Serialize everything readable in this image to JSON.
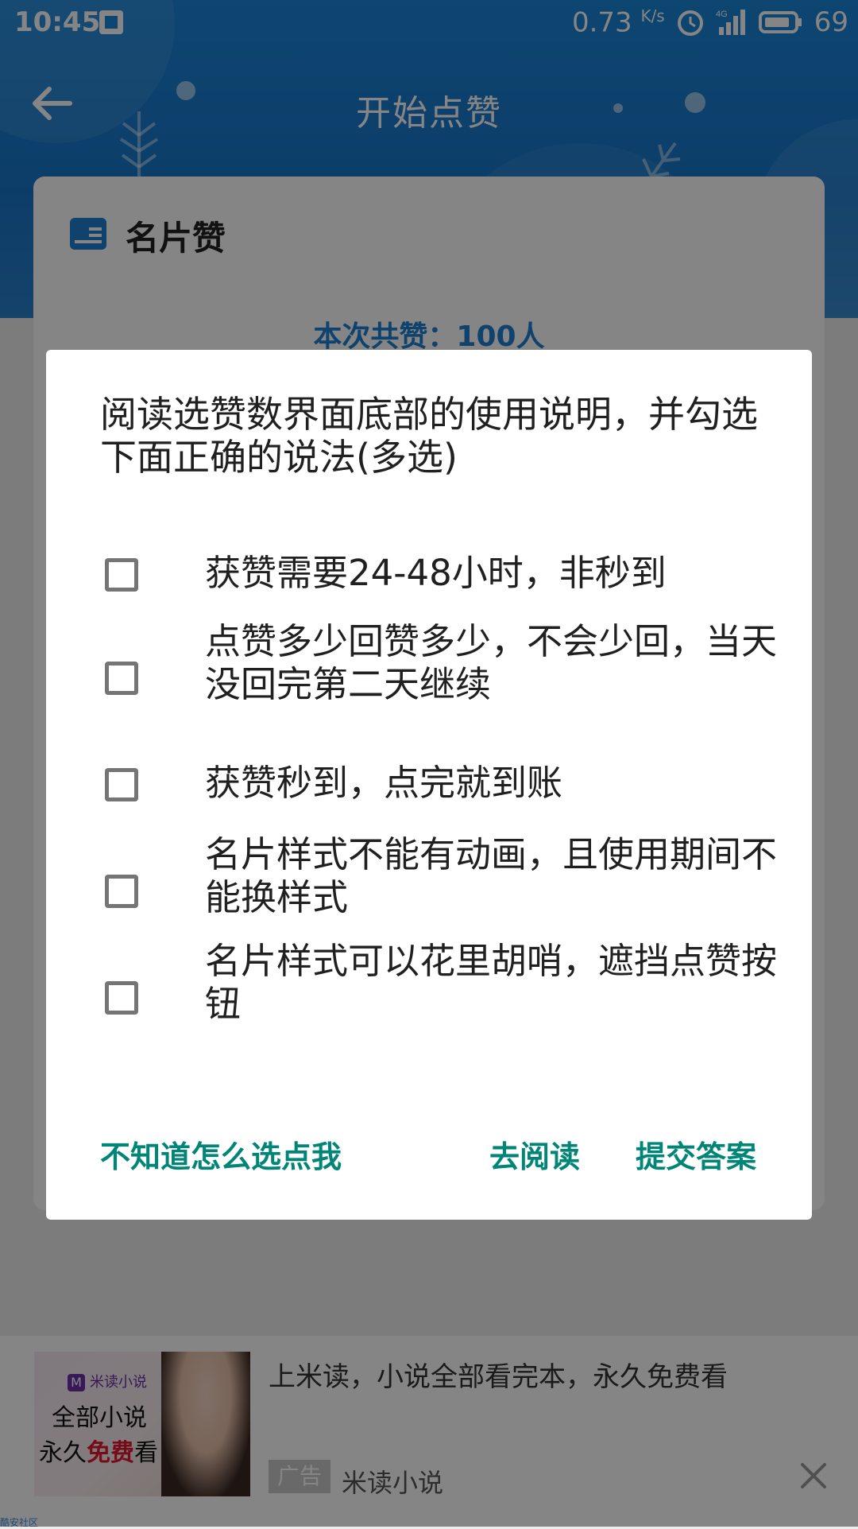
{
  "status_bar": {
    "time": "10:45",
    "speed_value": "0.73",
    "speed_unit": "K/s",
    "network": "4G",
    "battery": "69"
  },
  "app_bar": {
    "title": "开始点赞",
    "back_icon": "arrow-left-icon"
  },
  "card": {
    "title": "名片赞",
    "icon": "card-icon",
    "total_text": "本次共赞：100人"
  },
  "dialog": {
    "title": "阅读选赞数界面底部的使用说明，并勾选下面正确的说法(多选)",
    "options": [
      {
        "label": "获赞需要24-48小时，非秒到",
        "checked": false
      },
      {
        "label": "点赞多少回赞多少，不会少回，当天没回完第二天继续",
        "checked": false
      },
      {
        "label": "获赞秒到，点完就到账",
        "checked": false
      },
      {
        "label": "名片样式不能有动画，且使用期间不能换样式",
        "checked": false
      },
      {
        "label": "名片样式可以花里胡哨，遮挡点赞按钮",
        "checked": false
      }
    ],
    "buttons": {
      "help": "不知道怎么选点我",
      "read": "去阅读",
      "submit": "提交答案"
    },
    "accent_color": "#008577"
  },
  "ad": {
    "logo_text": "米读小说",
    "slogan_line1": "全部小说",
    "slogan_line2_prefix": "永久",
    "slogan_line2_highlight": "免费",
    "slogan_line2_suffix": "看",
    "headline": "上米读，小说全部看完本，永久免费看",
    "badge": "广告",
    "source": "米读小说"
  },
  "corner_note": "酷安社区"
}
